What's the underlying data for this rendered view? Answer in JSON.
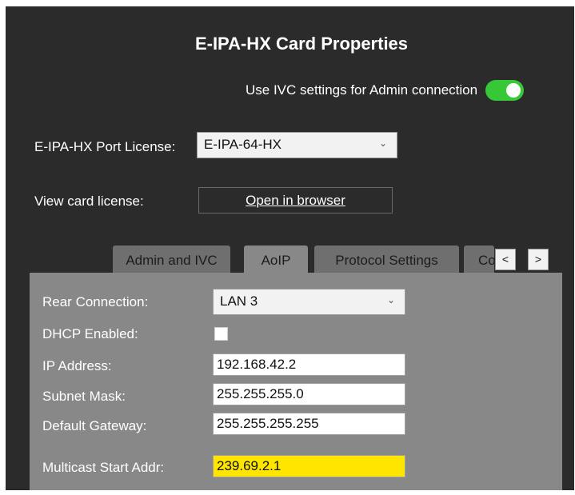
{
  "window": {
    "title": "E-IPA-HX Card Properties"
  },
  "ivc": {
    "label": "Use IVC settings for Admin connection",
    "enabled": true,
    "toggle_color": "#37c837"
  },
  "port_license": {
    "label": "E-IPA-HX Port License:",
    "value": "E-IPA-64-HX"
  },
  "card_license": {
    "label": "View card license:",
    "button_label": "Open in browser"
  },
  "tabs": [
    {
      "label": "Admin and IVC",
      "active": false
    },
    {
      "label": "AoIP",
      "active": true
    },
    {
      "label": "Protocol Settings",
      "active": false
    },
    {
      "label": "Co",
      "active": false
    }
  ],
  "tab_nav": {
    "prev": "<",
    "next": ">"
  },
  "aoip": {
    "rear_connection": {
      "label": "Rear Connection:",
      "value": "LAN 3"
    },
    "dhcp": {
      "label": "DHCP Enabled:",
      "checked": false
    },
    "ip_address": {
      "label": "IP Address:",
      "value": "192.168.42.2"
    },
    "subnet_mask": {
      "label": "Subnet Mask:",
      "value": "255.255.255.0"
    },
    "default_gateway": {
      "label": "Default Gateway:",
      "value": "255.255.255.255"
    },
    "multicast": {
      "label": "Multicast Start Addr:",
      "value": "239.69.2.1",
      "highlight_color": "#ffe600"
    }
  },
  "icons": {
    "dropdown": "chevron-down-icon"
  }
}
